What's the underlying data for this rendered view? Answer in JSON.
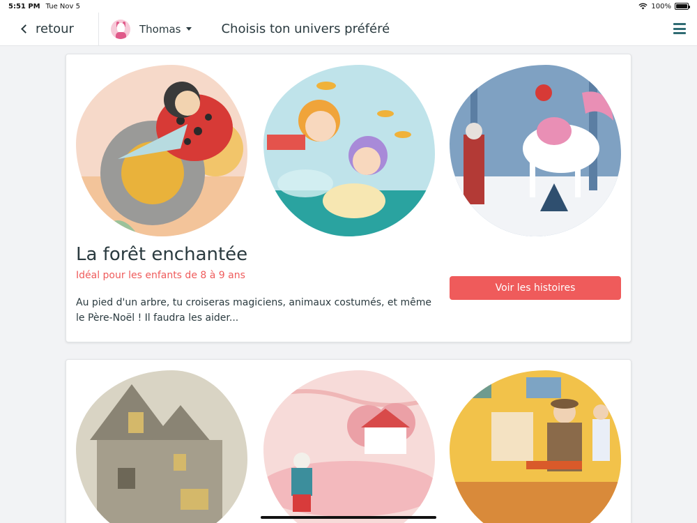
{
  "statusbar": {
    "time": "5:51 PM",
    "date": "Tue Nov 5",
    "battery": "100%",
    "battery_level": 1.0
  },
  "nav": {
    "back_label": "retour",
    "user_name": "Thomas",
    "title": "Choisis ton univers préféré"
  },
  "cards": [
    {
      "title": "La forêt enchantée",
      "subtitle": "Idéal pour les enfants de 8 à 9 ans",
      "description": "Au pied d'un arbre, tu croiseras magiciens, animaux costumés, et même le Père-Noël ! Il faudra les aider...",
      "cta": "Voir les histoires",
      "images": [
        "ladybug-rocket-illustration",
        "fairies-illustration",
        "unicorn-snow-illustration"
      ]
    },
    {
      "images": [
        "haunted-house-illustration",
        "pink-house-illustration",
        "painter-studio-illustration"
      ]
    }
  ],
  "colors": {
    "accent": "#ef5b5b",
    "text": "#2a3a3f",
    "menu": "#2f6b73",
    "background": "#f2f3f5"
  }
}
